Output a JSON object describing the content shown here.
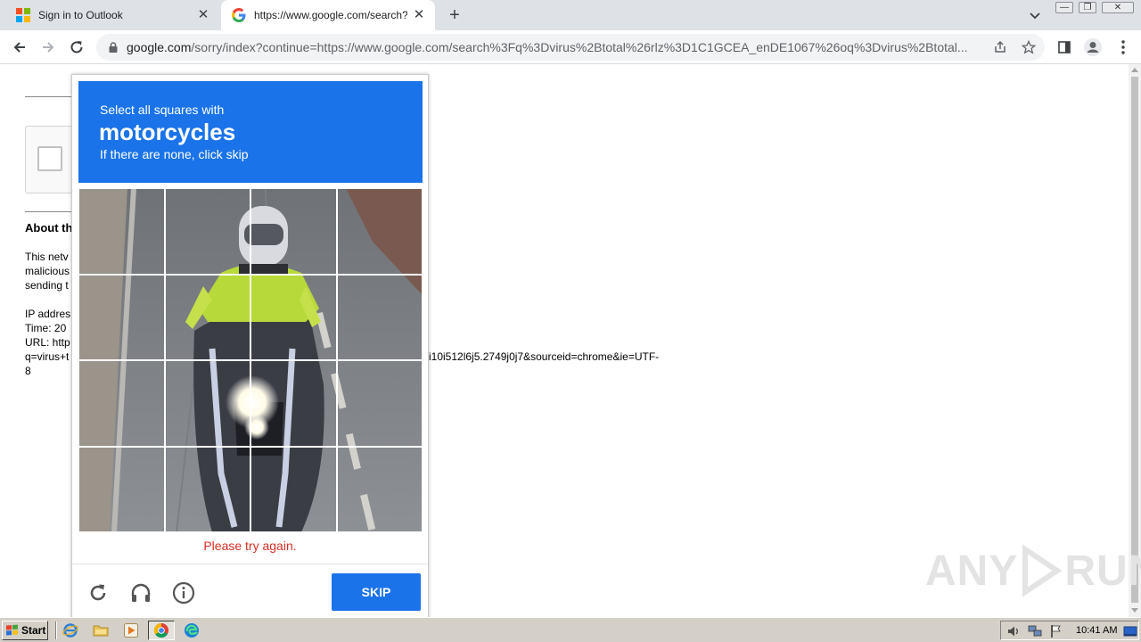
{
  "browser": {
    "tabs": [
      {
        "title": "Sign in to Outlook",
        "icon": "microsoft-icon",
        "active": false
      },
      {
        "title": "https://www.google.com/search?q=",
        "icon": "google-icon",
        "active": true
      }
    ],
    "address": {
      "host": "google.com",
      "path": "/sorry/index?continue=https://www.google.com/search%3Fq%3Dvirus%2Btotal%26rlz%3D1C1GCEA_enDE1067%26oq%3Dvirus%2Btotal..."
    }
  },
  "page": {
    "about_heading": "About th",
    "about_lines": [
      "This netv",
      "malicious",
      "sending t"
    ],
    "info_lines": [
      "IP addres",
      "Time: 20",
      "URL: http",
      "q=virus+t",
      "8"
    ],
    "url_tail": "i10i512l6j5.2749j0j7&sourceid=chrome&ie=UTF-"
  },
  "challenge": {
    "instruction_pre": "Select all squares with",
    "target": "motorcycles",
    "instruction_post": "If there are none, click skip",
    "grid": {
      "rows": 4,
      "cols": 4
    },
    "error": "Please try again.",
    "skip_label": "SKIP",
    "colors": {
      "header": "#1a73e8",
      "error": "#d93025"
    }
  },
  "watermark": {
    "left": "ANY",
    "right": "RUN"
  },
  "taskbar": {
    "start_label": "Start",
    "clock": "10:41 AM"
  }
}
